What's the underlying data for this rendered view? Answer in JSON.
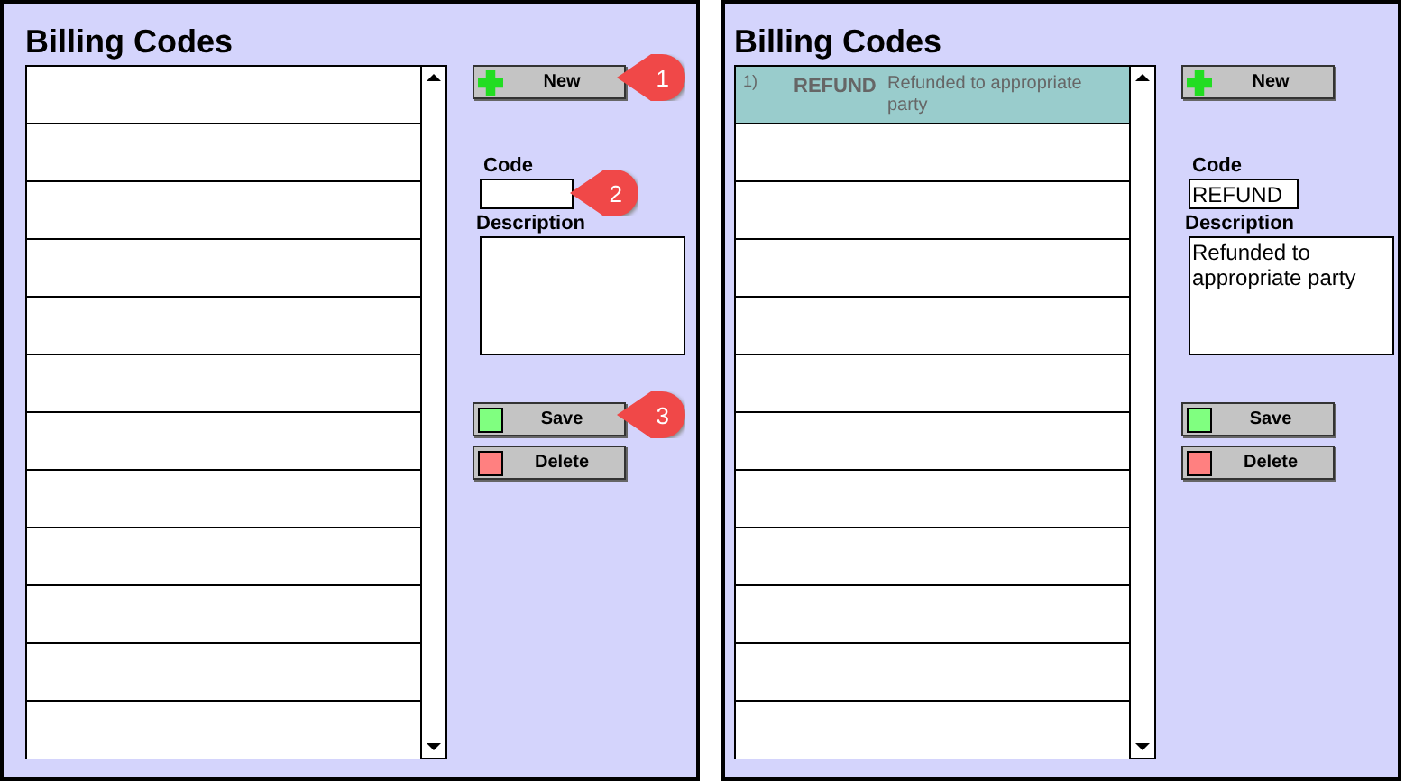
{
  "panels": [
    {
      "title": "Billing Codes",
      "rows": [
        {
          "selected": false
        },
        {
          "selected": false
        },
        {
          "selected": false
        },
        {
          "selected": false
        },
        {
          "selected": false
        },
        {
          "selected": false
        },
        {
          "selected": false
        },
        {
          "selected": false
        },
        {
          "selected": false
        },
        {
          "selected": false
        },
        {
          "selected": false
        },
        {
          "selected": false
        }
      ],
      "new_button": {
        "label": "New",
        "callout": "1"
      },
      "code": {
        "label": "Code",
        "callout": "2"
      },
      "description": {
        "label": "Description"
      },
      "save_button": {
        "label": "Save",
        "callout": "3"
      },
      "delete_button": {
        "label": "Delete"
      }
    },
    {
      "title": "Billing Codes",
      "rows": [
        {
          "selected": true,
          "number": "1)",
          "code": "REFUND",
          "description": "Refunded to appropriate party"
        },
        {
          "selected": false
        },
        {
          "selected": false
        },
        {
          "selected": false
        },
        {
          "selected": false
        },
        {
          "selected": false
        },
        {
          "selected": false
        },
        {
          "selected": false
        },
        {
          "selected": false
        },
        {
          "selected": false
        },
        {
          "selected": false
        },
        {
          "selected": false
        }
      ],
      "new_button": {
        "label": "New"
      },
      "code": {
        "label": "Code",
        "value": "REFUND"
      },
      "description": {
        "label": "Description",
        "value": "Refunded to appropriate party"
      },
      "save_button": {
        "label": "Save"
      },
      "delete_button": {
        "label": "Delete"
      }
    }
  ]
}
